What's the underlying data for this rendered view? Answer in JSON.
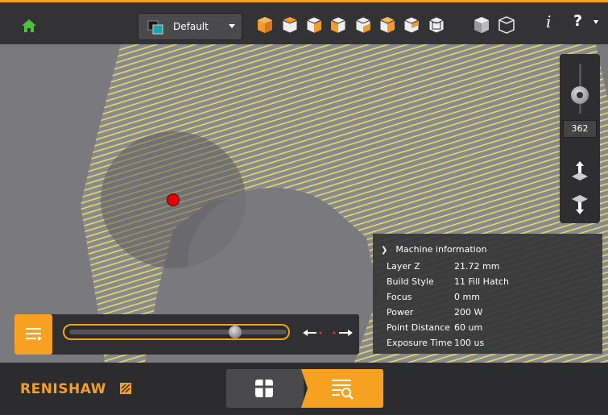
{
  "toolbar": {
    "view_preset": "Default",
    "view_cubes": [
      "front-view-cube-icon",
      "top-view-cube-icon",
      "right-view-cube-icon",
      "back-view-cube-icon",
      "left-view-cube-icon",
      "iso-view-cube-icon",
      "bottom-view-cube-icon",
      "perspective-cube-icon",
      "orthographic-cube-icon"
    ],
    "info_label": "i",
    "help_label": "?"
  },
  "zoom": {
    "value": "362"
  },
  "machine_info": {
    "title": "Machine information",
    "rows": [
      {
        "key": "Layer Z",
        "value": "21.72 mm"
      },
      {
        "key": "Build Style",
        "value": "11 Fill Hatch"
      },
      {
        "key": "Focus",
        "value": "0 mm"
      },
      {
        "key": "Power",
        "value": "200 W"
      },
      {
        "key": "Point Distance",
        "value": "60 um"
      },
      {
        "key": "Exposure Time",
        "value": "100 us"
      }
    ]
  },
  "playback": {
    "position_fraction": 0.78
  },
  "brand": {
    "logo_text": "RENISHAW"
  },
  "colors": {
    "accent": "#f7a123",
    "hatch": "#e8e060",
    "laser_point": "#e00000"
  }
}
